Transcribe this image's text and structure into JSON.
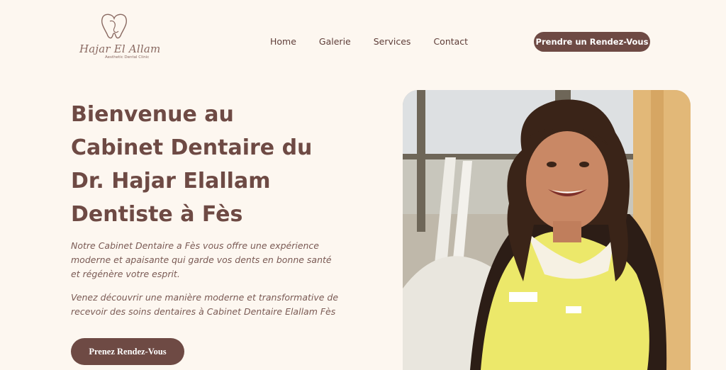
{
  "logo": {
    "name": "Hajar El Allam",
    "subtitle": "Aesthetic Dental Clinic"
  },
  "nav": {
    "items": [
      "Home",
      "Galerie",
      "Services",
      "Contact"
    ]
  },
  "header": {
    "cta_label": "Prendre un Rendez-Vous"
  },
  "hero": {
    "title_lines": [
      "Bienvenue au",
      "Cabinet Dentaire du",
      "Dr. Hajar Elallam",
      "Dentiste à Fès"
    ],
    "paragraph1": "Notre Cabinet Dentaire a Fès vous offre une expérience moderne et apaisante qui garde vos dents en bonne santé et régénère votre esprit.",
    "paragraph2": "Venez découvrir une manière moderne et transformative de recevoir des soins dentaires à Cabinet Dentaire Elallam Fès",
    "cta_label": "Prenez Rendez-Vous"
  },
  "colors": {
    "background": "#fdf7f0",
    "brand": "#6e4a44",
    "uniform": "#ece86a"
  },
  "icons": {
    "logo_mark": "tooth-icon"
  }
}
